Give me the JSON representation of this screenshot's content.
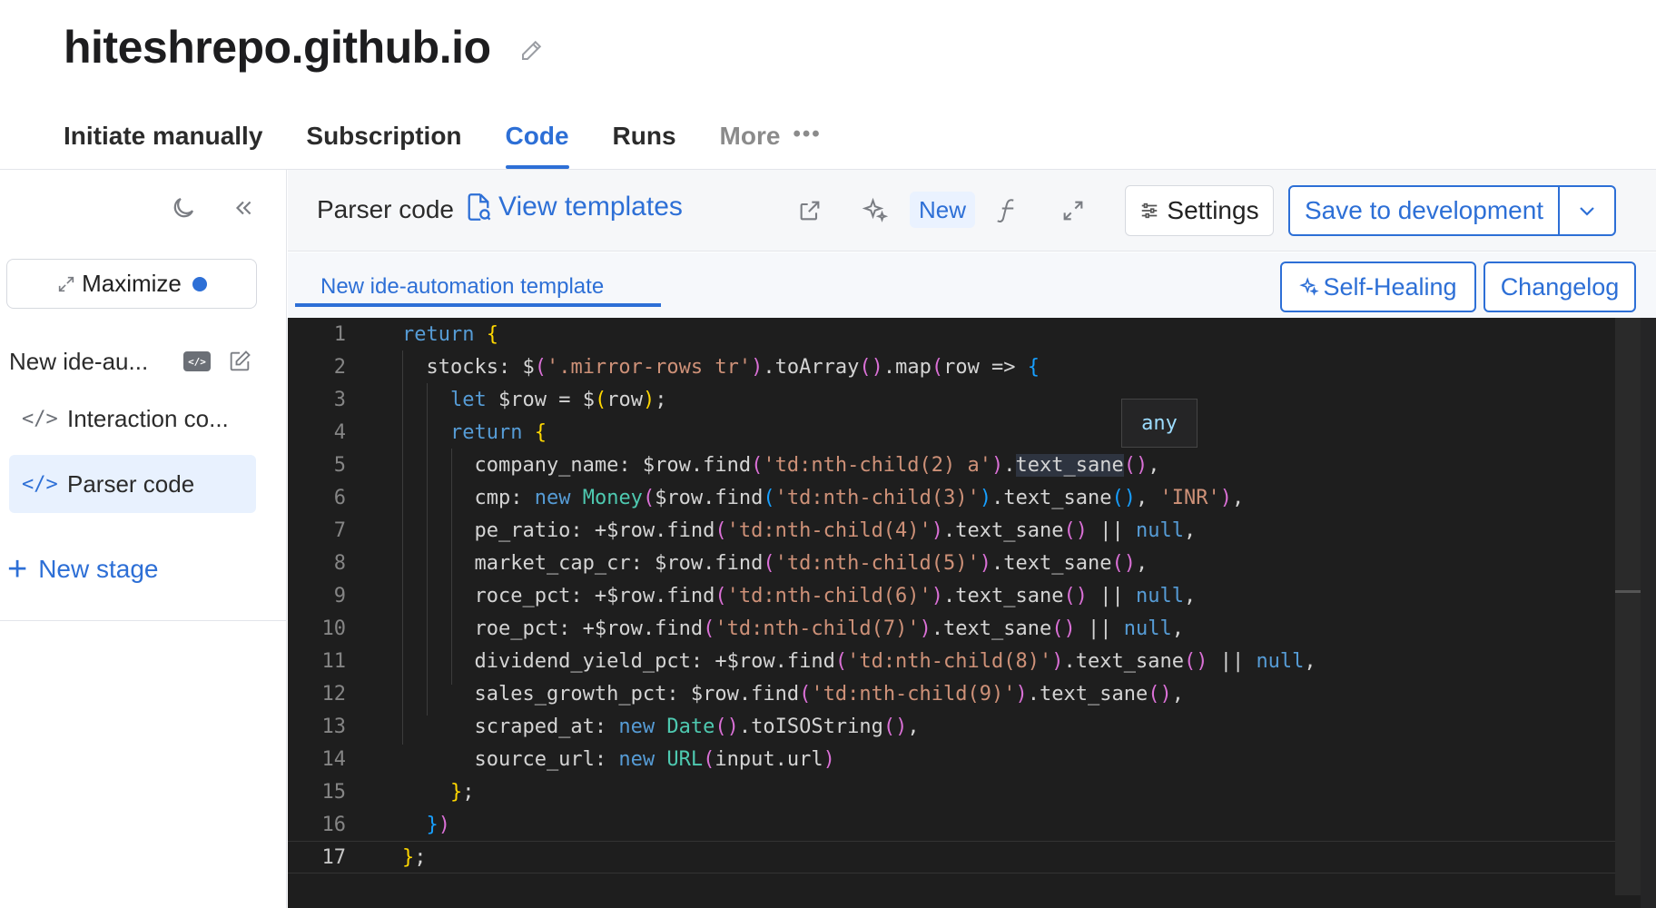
{
  "header": {
    "title": "hiteshrepo.github.io",
    "tabs": [
      "Initiate manually",
      "Subscription",
      "Code",
      "Runs",
      "More"
    ],
    "more_dots": "•••"
  },
  "sidebar": {
    "maximize_label": "Maximize",
    "template_name": "New ide-au...",
    "badge": "</>",
    "stages": [
      {
        "glyph": "</>",
        "label": "Interaction co..."
      },
      {
        "glyph": "</>",
        "label": "Parser code"
      }
    ],
    "new_stage_label": "New stage",
    "new_stage_plus": "+"
  },
  "toolbar": {
    "title": "Parser code",
    "view_templates": "View templates",
    "new_badge": "New",
    "settings": "Settings",
    "save": "Save to development"
  },
  "subbar": {
    "file_tab": "New ide-automation template",
    "self_healing": "Self-Healing",
    "changelog": "Changelog"
  },
  "editor": {
    "hover_type": "any",
    "current_line": 17,
    "lines": [
      "return {",
      "  stocks: $('.mirror-rows tr').toArray().map(row => {",
      "    let $row = $(row);",
      "    return {",
      "      company_name: $row.find('td:nth-child(2) a').text_sane(),",
      "      cmp: new Money($row.find('td:nth-child(3)').text_sane(), 'INR'),",
      "      pe_ratio: +$row.find('td:nth-child(4)').text_sane() || null,",
      "      market_cap_cr: $row.find('td:nth-child(5)').text_sane(),",
      "      roce_pct: +$row.find('td:nth-child(6)').text_sane() || null,",
      "      roe_pct: +$row.find('td:nth-child(7)').text_sane() || null,",
      "      dividend_yield_pct: +$row.find('td:nth-child(8)').text_sane() || null,",
      "      sales_growth_pct: $row.find('td:nth-child(9)').text_sane(),",
      "      scraped_at: new Date().toISOString(),",
      "      source_url: new URL(input.url)",
      "    };",
      "  })",
      "};"
    ]
  },
  "colors": {
    "accent": "#2d6fd6",
    "editor_bg": "#1e1e1e",
    "keyword": "#569cd6",
    "string": "#ce9178",
    "type": "#4ec9b0"
  }
}
